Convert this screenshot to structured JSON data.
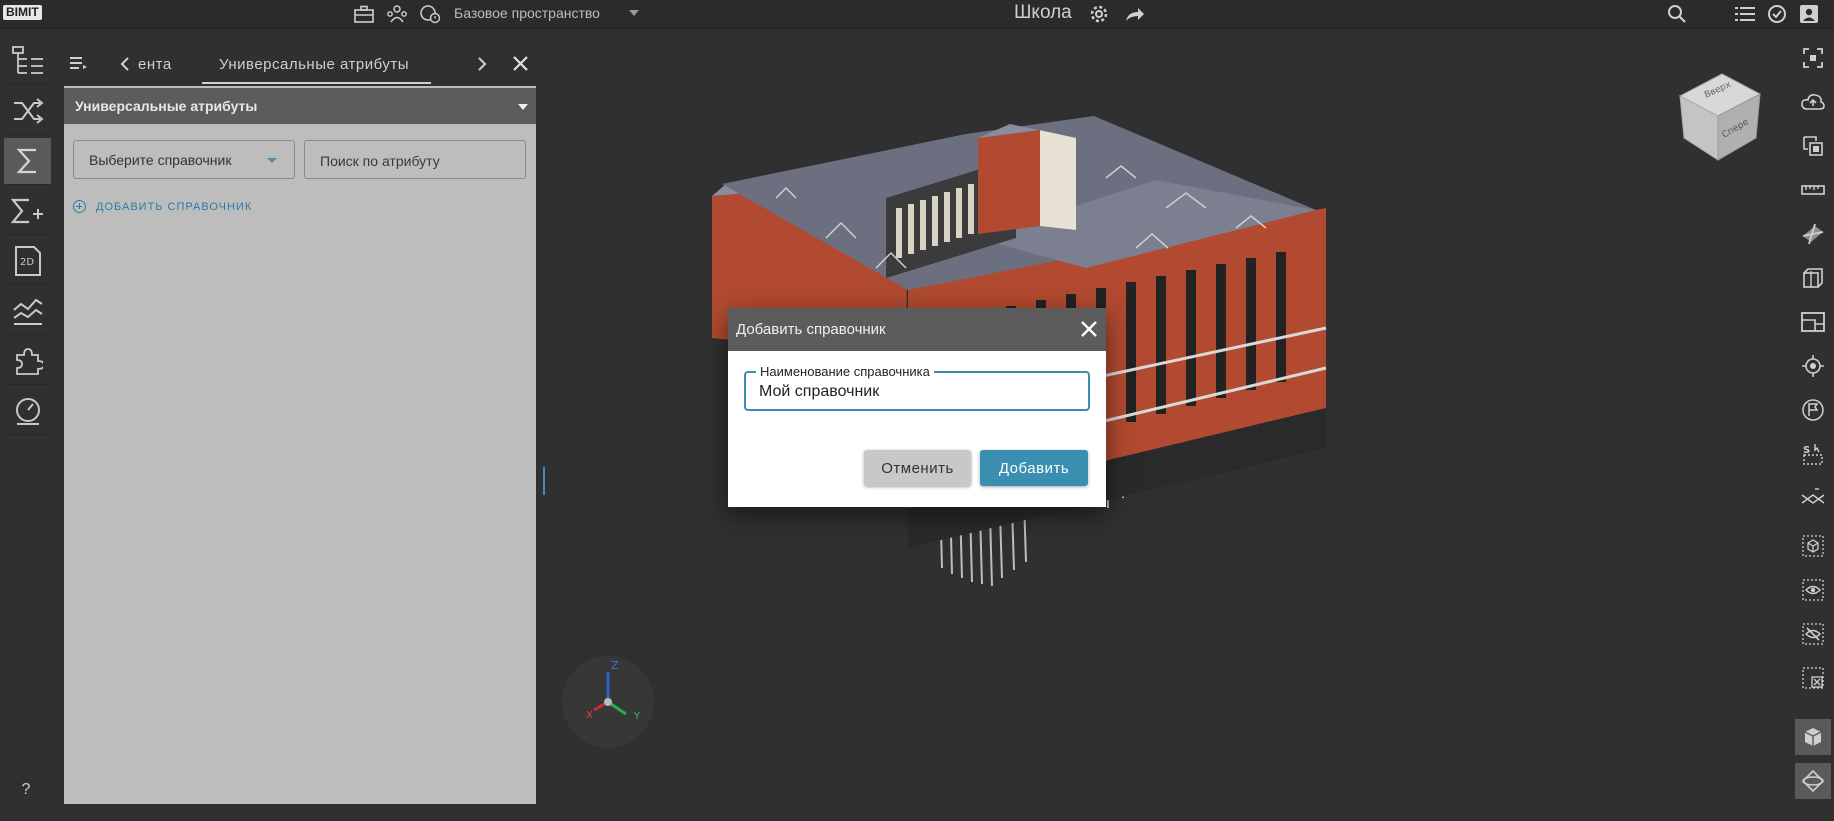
{
  "app": {
    "logo": "BIMIT",
    "project_title": "Школа"
  },
  "topbar": {
    "space_select": "Базовое пространство"
  },
  "panel": {
    "tabs": [
      {
        "label": "ента"
      },
      {
        "label": "Универсальные атрибуты"
      }
    ],
    "section_title": "Универсальные атрибуты",
    "directory_select": "Выберите справочник",
    "attribute_search_placeholder": "Поиск по атрибуту",
    "add_directory_label": "ДОБАВИТЬ СПРАВОЧНИК"
  },
  "help_label": "?",
  "viewcube": {
    "faces": [
      "Вверх",
      "Спере"
    ]
  },
  "axes": {
    "z": "Z",
    "x": "X",
    "y": "Y"
  },
  "dialog": {
    "title": "Добавить справочник",
    "field_label": "Наименование справочника",
    "field_value": "Мой справочник",
    "cancel_label": "Отменить",
    "add_label": "Добавить"
  },
  "colors": {
    "accent": "#3a8fb0",
    "dialog_header": "#5c5c5c",
    "panel_bg": "#bdbdbd",
    "app_bg": "#303030"
  }
}
